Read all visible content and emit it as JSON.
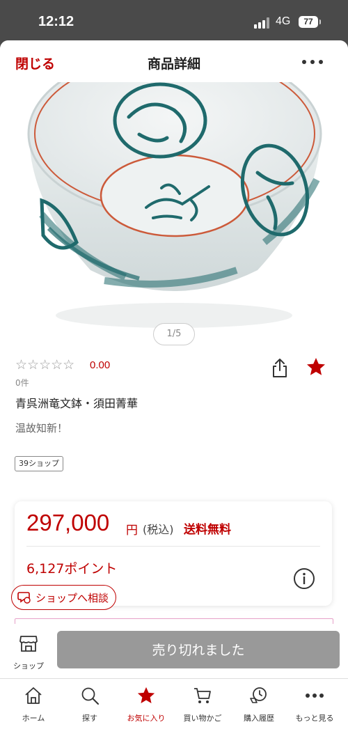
{
  "status_bar": {
    "time": "12:12",
    "network": "4G",
    "battery": "77"
  },
  "header": {
    "close_label": "閉じる",
    "title": "商品詳細"
  },
  "gallery": {
    "pager": "1/5"
  },
  "product": {
    "stars": "☆☆☆☆☆",
    "rating": "0.00",
    "review_count": "0件",
    "name": "青呉洲竜文鉢・須田菁華",
    "tagline": "温故知新！",
    "shop_badge": "39ショップ"
  },
  "pricing": {
    "price": "297,000",
    "currency": "円",
    "tax_note": "(税込)",
    "shipping": "送料無料",
    "points": "6,127ポイント"
  },
  "consult_button": {
    "label": "ショップへ相談"
  },
  "action_bar": {
    "shop_label": "ショップ",
    "soldout_label": "売り切れました"
  },
  "tabs": [
    {
      "label": "ホーム",
      "icon": "home-icon"
    },
    {
      "label": "探す",
      "icon": "search-icon"
    },
    {
      "label": "お気に入り",
      "icon": "star-icon"
    },
    {
      "label": "買い物かご",
      "icon": "cart-icon"
    },
    {
      "label": "購入履歴",
      "icon": "history-icon"
    },
    {
      "label": "もっと見る",
      "icon": "more-icon"
    }
  ],
  "colors": {
    "accent": "#bf0000",
    "disabled": "#999999",
    "badge_border": "#888888"
  }
}
